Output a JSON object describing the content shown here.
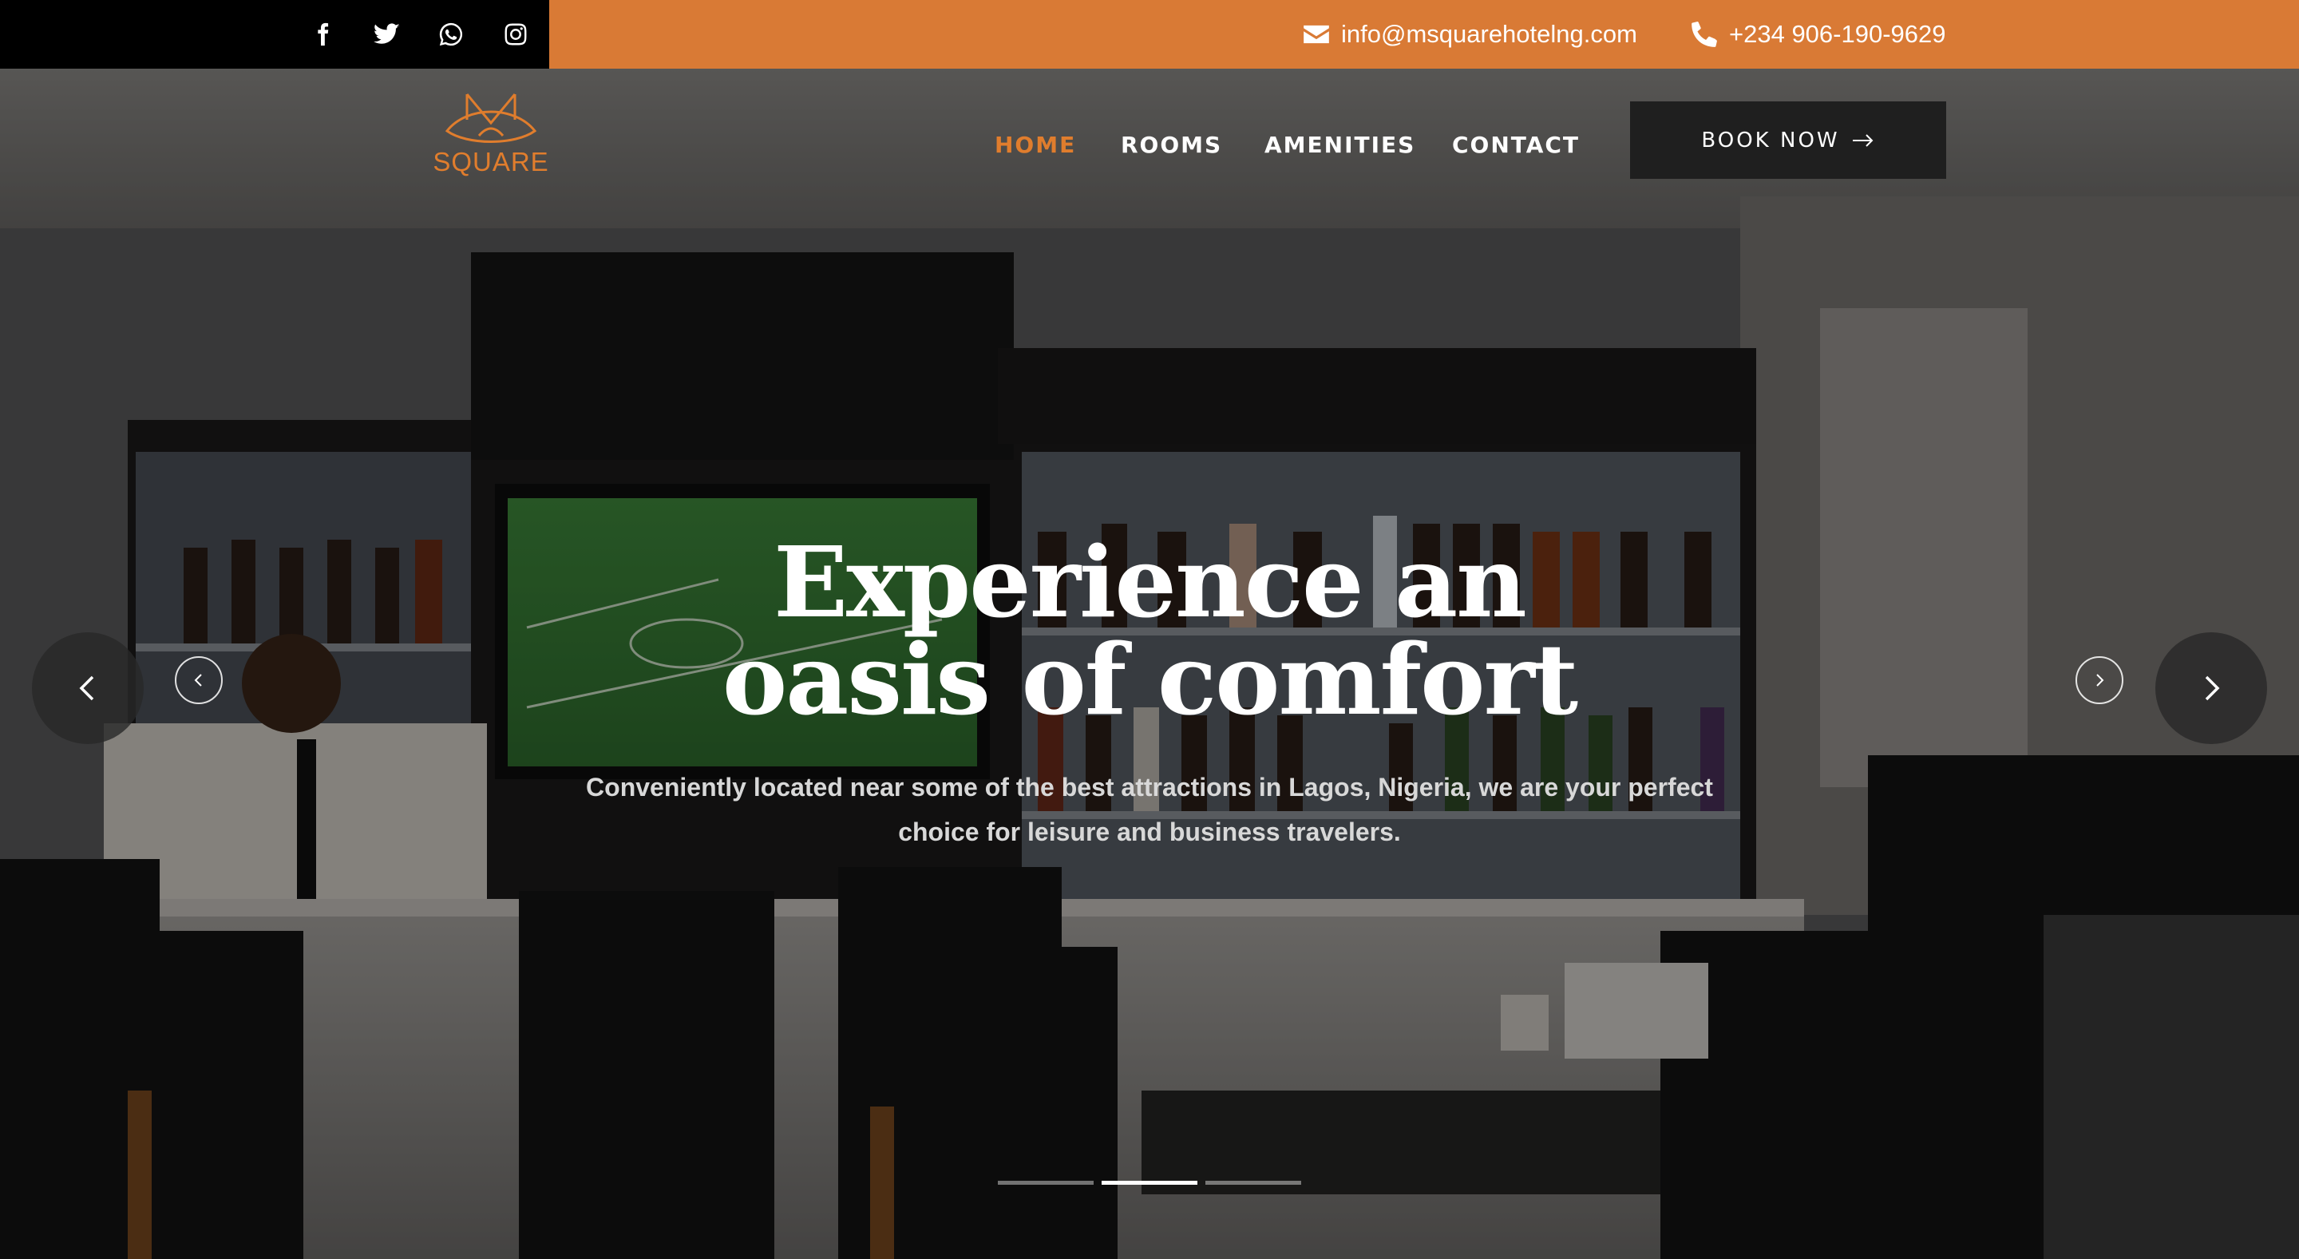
{
  "topbar": {
    "social": [
      {
        "name": "facebook-icon"
      },
      {
        "name": "twitter-icon"
      },
      {
        "name": "whatsapp-icon"
      },
      {
        "name": "instagram-icon"
      }
    ],
    "email": "info@msquarehotelng.com",
    "phone": "+234 906-190-9629",
    "accent_color": "#d97a35"
  },
  "brand": {
    "logo_text": "SQUARE",
    "logo_color": "#e07d2d"
  },
  "nav": {
    "items": [
      {
        "label": "HOME",
        "active": true
      },
      {
        "label": "ROOMS",
        "active": false
      },
      {
        "label": "AMENITIES",
        "active": false
      },
      {
        "label": "CONTACT",
        "active": false
      }
    ],
    "book_label": "BOOK NOW"
  },
  "hero": {
    "headline_line1": "Experience an",
    "headline_line2": "oasis of comfort",
    "subtext": "Conveniently located near some of the best attractions in Lagos, Nigeria, we are your perfect choice for leisure and business travelers.",
    "slides_total": 3,
    "active_slide": 2
  }
}
